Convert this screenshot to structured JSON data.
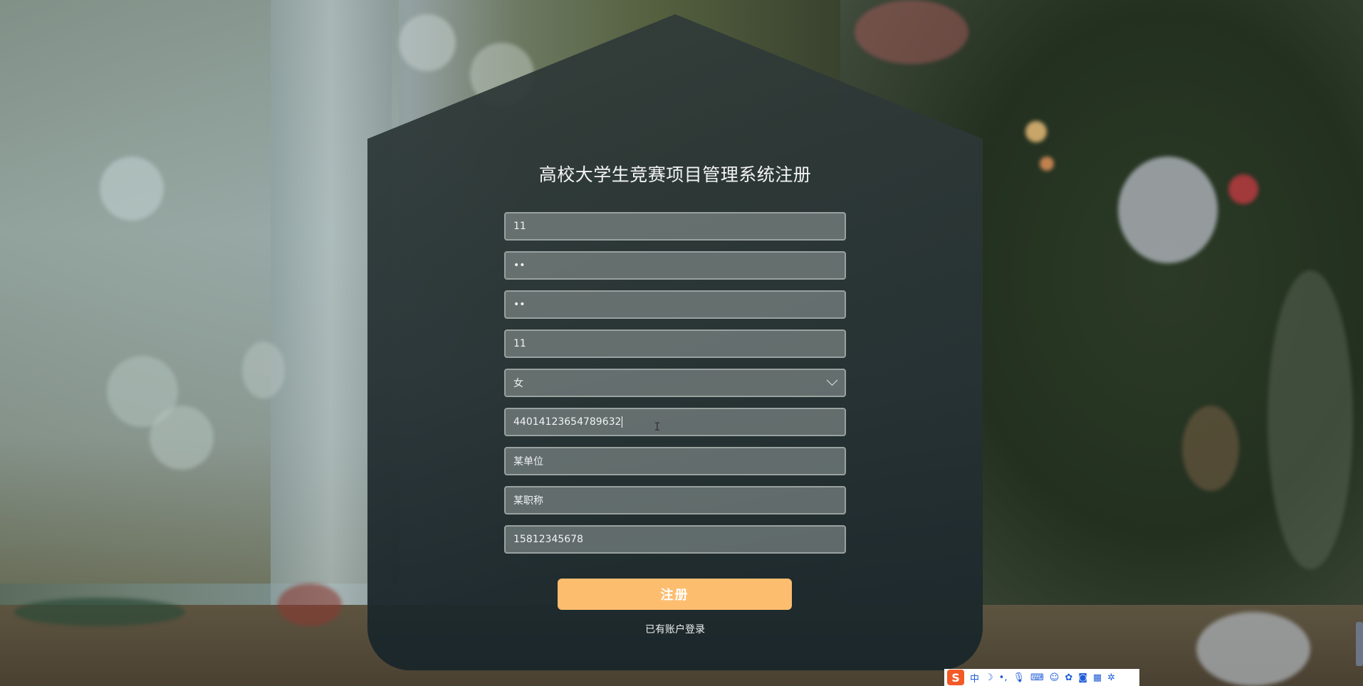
{
  "page": {
    "title": "高校大学生竞赛项目管理系统注册"
  },
  "form": {
    "fields": [
      {
        "value": "11"
      },
      {
        "value": "••"
      },
      {
        "value": "••"
      },
      {
        "value": "11"
      },
      {
        "value": "女"
      },
      {
        "value": "44014123654789632"
      },
      {
        "value": "某单位"
      },
      {
        "value": "某职称"
      },
      {
        "value": "15812345678"
      }
    ],
    "submit_label": "注册",
    "login_link": "已有账户登录"
  },
  "ime_tray": {
    "logo": "S",
    "mode": "中",
    "icons": [
      "moon-icon",
      "punctuation-icon",
      "microphone-icon",
      "keyboard-icon",
      "user-icon",
      "skin-icon",
      "game-icon",
      "grid-icon",
      "settings-icon"
    ]
  },
  "colors": {
    "accent": "#fdbd6f",
    "card": "#2a383c"
  }
}
